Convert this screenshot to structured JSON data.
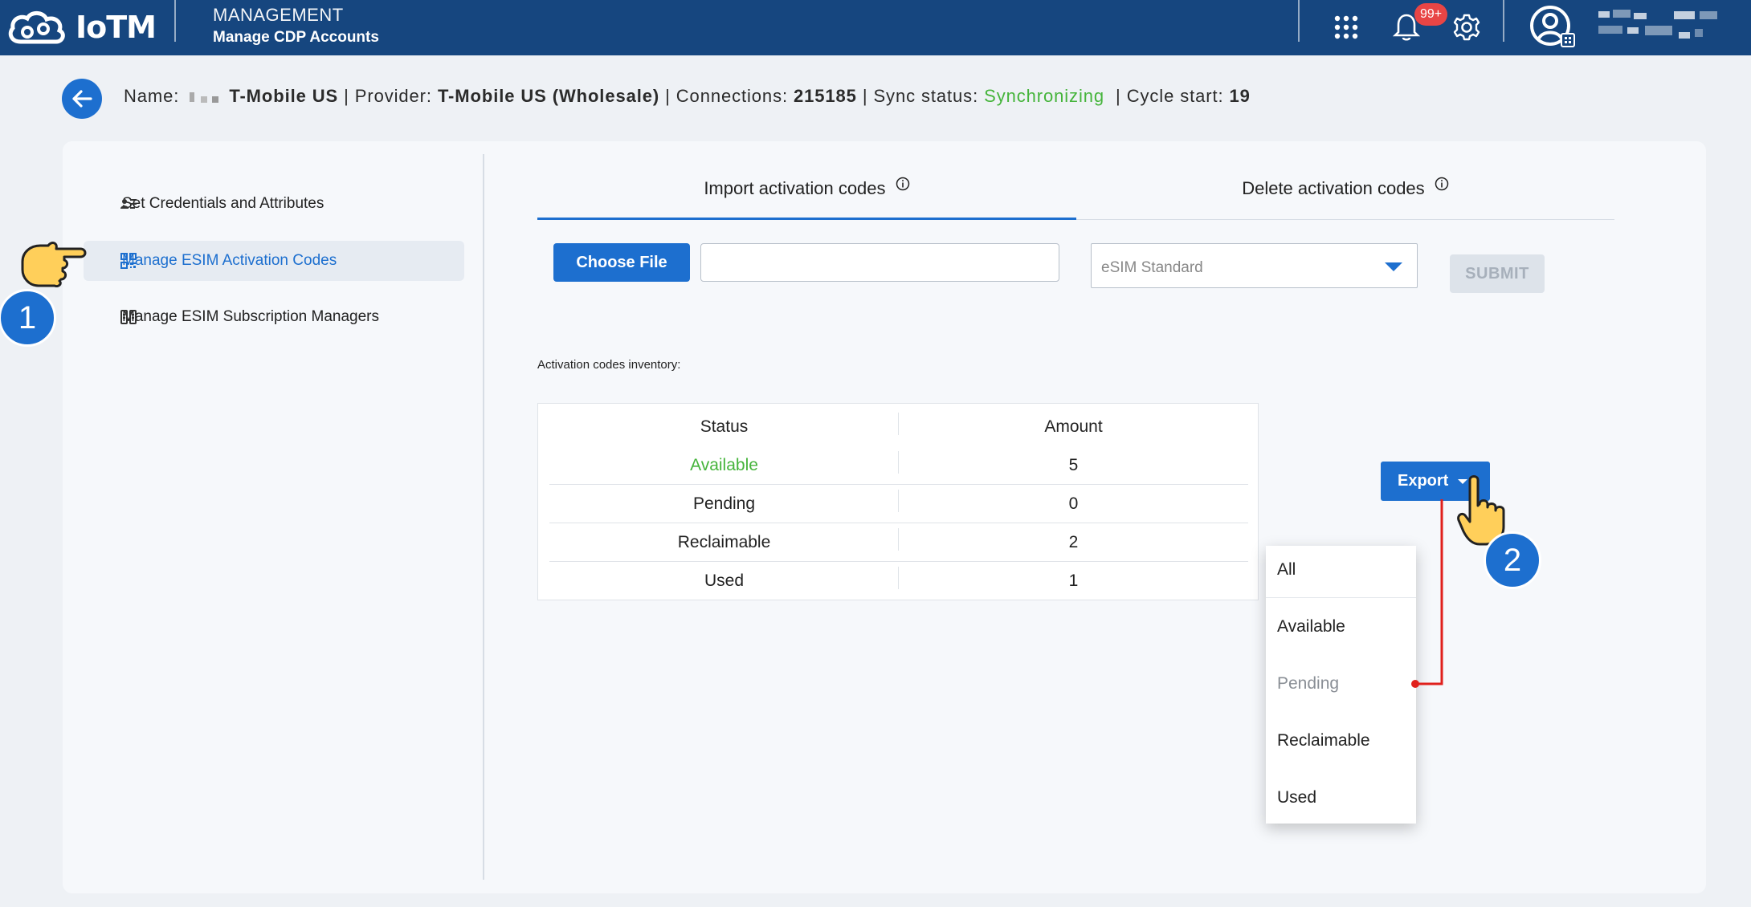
{
  "topbar": {
    "logo_text": "IoTM",
    "section_title": "MANAGEMENT",
    "section_subtitle": "Manage CDP Accounts",
    "notification_badge": "99+",
    "icons": [
      "apps-grid-icon",
      "bell-icon",
      "gear-icon",
      "user-avatar-icon"
    ]
  },
  "account_info": {
    "name_label": "Name:",
    "name_value": "T-Mobile US",
    "provider_label": "Provider:",
    "provider_value": "T-Mobile US (Wholesale)",
    "connections_label": "Connections:",
    "connections_value": "215185",
    "sync_label": "Sync status:",
    "sync_value": "Synchronizing",
    "cycle_label": "Cycle start:",
    "cycle_value": "19",
    "separator": "|"
  },
  "sidebar": {
    "items": [
      {
        "label": "Set Credentials and Attributes",
        "icon": "credentials-icon"
      },
      {
        "label": "Manage ESIM Activation Codes",
        "icon": "qr-code-icon",
        "active": true
      },
      {
        "label": "Manage ESIM Subscription Managers",
        "icon": "sim-manager-icon"
      }
    ]
  },
  "tabs": {
    "import_label": "Import activation codes",
    "delete_label": "Delete activation codes"
  },
  "import_form": {
    "choose_file_label": "Choose File",
    "file_value": "",
    "select_value": "eSIM Standard",
    "submit_label": "SUBMIT"
  },
  "inventory": {
    "label": "Activation codes inventory:",
    "headers": [
      "Status",
      "Amount"
    ],
    "rows": [
      {
        "status": "Available",
        "amount": "5"
      },
      {
        "status": "Pending",
        "amount": "0"
      },
      {
        "status": "Reclaimable",
        "amount": "2"
      },
      {
        "status": "Used",
        "amount": "1"
      }
    ]
  },
  "export": {
    "button_label": "Export",
    "menu_items": [
      "All",
      "Available",
      "Pending",
      "Reclaimable",
      "Used"
    ]
  },
  "annotations": {
    "marker_1": "1",
    "marker_2": "2"
  },
  "colors": {
    "topbar": "#16467f",
    "accent": "#1d6fcf",
    "sync_green": "#45b43b",
    "connector_red": "#e0201c"
  }
}
